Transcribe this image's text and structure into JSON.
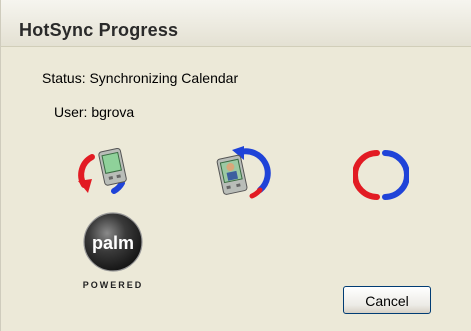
{
  "window": {
    "title": "HotSync Progress"
  },
  "status": {
    "text": "Status: Synchronizing Calendar"
  },
  "user": {
    "text": "User: bgrova"
  },
  "icons": {
    "sync_to_handheld": "handheld-sync-icon",
    "sync_from_handheld": "user-handheld-sync-icon",
    "sync_progress": "sync-circle-icon"
  },
  "logo": {
    "word": "palm",
    "tagline": "POWERED"
  },
  "buttons": {
    "cancel_label": "Cancel"
  },
  "colors": {
    "window_bg": "#ece9d8",
    "arrow_red": "#e21b23",
    "arrow_blue": "#1f43d8"
  }
}
